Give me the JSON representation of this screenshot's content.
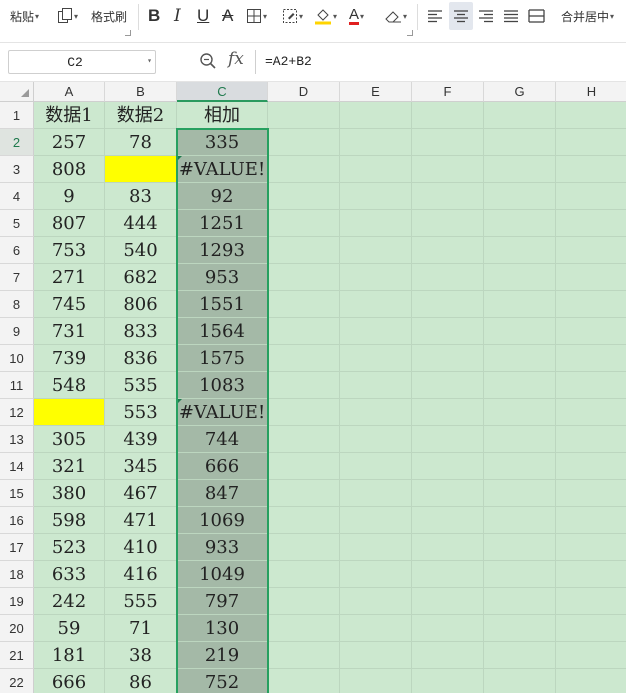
{
  "toolbar": {
    "paste_label": "粘贴",
    "format_painter_label": "格式刷",
    "bold_glyph": "B",
    "italic_glyph": "I",
    "underline_glyph": "U",
    "strike_glyph": "A",
    "font_color_glyph": "A",
    "merge_center_label": "合并居中",
    "font_color": "#e02020",
    "fill_color": "#ffd400"
  },
  "formula_bar": {
    "cell_ref": "C2",
    "fx_label": "fx",
    "formula": "=A2+B2"
  },
  "sheet": {
    "columns": [
      "A",
      "B",
      "C",
      "D",
      "E",
      "F",
      "G",
      "H"
    ],
    "active_column": "C",
    "active_cell": "C2",
    "rows": [
      {
        "num": "1",
        "a": "数据1",
        "b": "数据2",
        "c": "相加"
      },
      {
        "num": "2",
        "a": "257",
        "b": "78",
        "c": "335"
      },
      {
        "num": "3",
        "a": "808",
        "b": "",
        "c": "#VALUE!",
        "b_fill": "#ffff00",
        "c_error": true
      },
      {
        "num": "4",
        "a": "9",
        "b": "83",
        "c": "92"
      },
      {
        "num": "5",
        "a": "807",
        "b": "444",
        "c": "1251"
      },
      {
        "num": "6",
        "a": "753",
        "b": "540",
        "c": "1293"
      },
      {
        "num": "7",
        "a": "271",
        "b": "682",
        "c": "953"
      },
      {
        "num": "8",
        "a": "745",
        "b": "806",
        "c": "1551"
      },
      {
        "num": "9",
        "a": "731",
        "b": "833",
        "c": "1564"
      },
      {
        "num": "10",
        "a": "739",
        "b": "836",
        "c": "1575"
      },
      {
        "num": "11",
        "a": "548",
        "b": "535",
        "c": "1083"
      },
      {
        "num": "12",
        "a": "",
        "b": "553",
        "c": "#VALUE!",
        "a_fill": "#ffff00",
        "c_error": true
      },
      {
        "num": "13",
        "a": "305",
        "b": "439",
        "c": "744"
      },
      {
        "num": "14",
        "a": "321",
        "b": "345",
        "c": "666"
      },
      {
        "num": "15",
        "a": "380",
        "b": "467",
        "c": "847"
      },
      {
        "num": "16",
        "a": "598",
        "b": "471",
        "c": "1069"
      },
      {
        "num": "17",
        "a": "523",
        "b": "410",
        "c": "933"
      },
      {
        "num": "18",
        "a": "633",
        "b": "416",
        "c": "1049"
      },
      {
        "num": "19",
        "a": "242",
        "b": "555",
        "c": "797"
      },
      {
        "num": "20",
        "a": "59",
        "b": "71",
        "c": "130"
      },
      {
        "num": "21",
        "a": "181",
        "b": "38",
        "c": "219"
      },
      {
        "num": "22",
        "a": "666",
        "b": "86",
        "c": "752"
      }
    ]
  },
  "colors": {
    "sheet_bg": "#cce8cf",
    "selection_fill": "#a4b9a7",
    "selection_border": "#27a060"
  }
}
